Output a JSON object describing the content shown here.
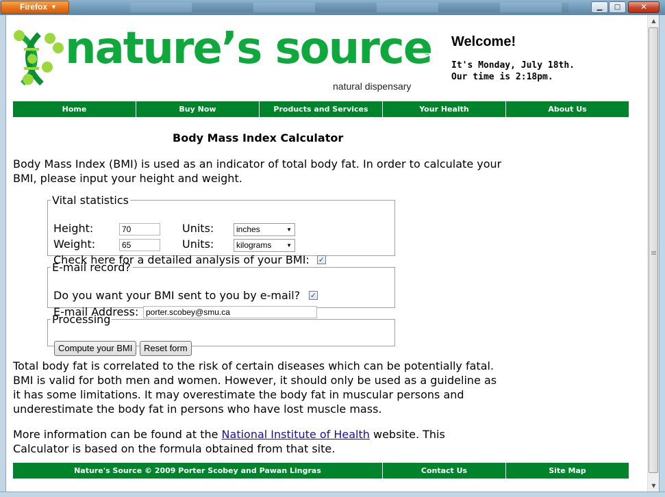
{
  "browser": {
    "menu_button": "Firefox",
    "window_controls": {
      "minimize": "▁",
      "maximize": "□",
      "close": "✕"
    }
  },
  "header": {
    "logo_text": "nature’s source",
    "logo_tm": "™",
    "logo_subtitle": "natural dispensary",
    "welcome_title": "Welcome!",
    "date_line": "It's Monday, July 18th.",
    "time_line": "Our time is 2:18pm."
  },
  "nav": [
    "Home",
    "Buy Now",
    "Products and Services",
    "Your Health",
    "About Us"
  ],
  "main": {
    "title": "Body Mass Index Calculator",
    "intro": "Body Mass Index (BMI) is used as an indicator of total body fat. In order to calculate your BMI, please input your height and weight.",
    "vital": {
      "legend": "Vital statistics",
      "height_label": "Height:",
      "height_value": "70",
      "height_units_label": "Units:",
      "height_units": "inches",
      "weight_label": "Weight:",
      "weight_value": "65",
      "weight_units_label": "Units:",
      "weight_units": "kilograms",
      "analysis_label": "Check here for a detailed analysis of your BMI:",
      "analysis_checked": true
    },
    "email": {
      "legend": "E-mail record?",
      "send_label": "Do you want your BMI sent to you by e-mail?",
      "send_checked": true,
      "address_label": "E-mail Address:",
      "address_value": "porter.scobey@smu.ca"
    },
    "processing": {
      "legend": "Processing",
      "compute_button": "Compute your BMI",
      "reset_button": "Reset form"
    },
    "body_text": "Total body fat is correlated to the risk of certain diseases which can be potentially fatal. BMI is valid for both men and women. However, it should only be used as a guideline as it has some limitations. It may overestimate the body fat in muscular persons and underestimate the body fat in persons who have lost muscle mass.",
    "more_info_prefix": "More information can be found at the ",
    "more_info_link": "National Institute of Health",
    "more_info_suffix": " website. This Calculator is based on the formula obtained from that site."
  },
  "footer": {
    "copyright": "Nature's Source © 2009 Porter Scobey and Pawan Lingras",
    "contact": "Contact Us",
    "sitemap": "Site Map"
  },
  "colors": {
    "brand_green": "#0ea83c",
    "nav_green": "#00842b",
    "link": "#1a0dab"
  },
  "icons": [
    "firefox-menu-icon",
    "dna-logo-icon",
    "checkbox-checked-icon",
    "dropdown-arrow-icon",
    "scroll-up-icon",
    "scroll-down-icon"
  ]
}
